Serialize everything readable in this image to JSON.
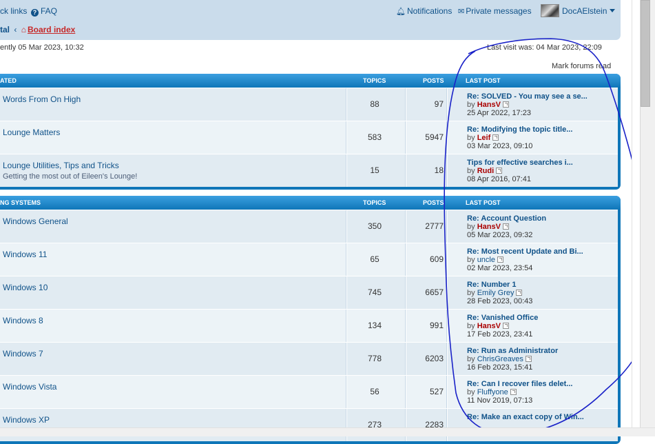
{
  "navbar": {
    "quick_links": "ck links",
    "faq": "FAQ",
    "notifications": "Notifications",
    "private_messages": "Private messages",
    "username": "DocAElstein",
    "breadcrumb_prev": "tal",
    "breadcrumb_sep": "‹",
    "board_index": "Board index"
  },
  "status": {
    "time_now": "ently 05 Mar 2023, 10:32",
    "last_visit": "Last visit was: 04 Mar 2023, 22:09",
    "mark_read": "Mark forums read"
  },
  "sections": [
    {
      "title": "ATED",
      "col_topics": "TOPICS",
      "col_posts": "POSTS",
      "col_last": "LAST POST",
      "rows": [
        {
          "name": "Words From On High",
          "desc": "",
          "topics": "88",
          "posts": "97",
          "lp_title": "Re: SOLVED - You may see a se...",
          "by": "by",
          "author": "HansV",
          "admin": true,
          "date": "25 Apr 2022, 17:23"
        },
        {
          "name": "Lounge Matters",
          "desc": "",
          "topics": "583",
          "posts": "5947",
          "lp_title": "Re: Modifying the topic title...",
          "by": "by",
          "author": "Leif",
          "admin": true,
          "date": "03 Mar 2023, 09:10"
        },
        {
          "name": "Lounge Utilities, Tips and Tricks",
          "desc": "Getting the most out of Eileen's Lounge!",
          "topics": "15",
          "posts": "18",
          "lp_title": "Tips for effective searches i...",
          "by": "by",
          "author": "Rudi",
          "admin": true,
          "date": "08 Apr 2016, 07:41"
        }
      ]
    },
    {
      "title": "NG SYSTEMS",
      "col_topics": "TOPICS",
      "col_posts": "POSTS",
      "col_last": "LAST POST",
      "rows": [
        {
          "name": "Windows General",
          "desc": "",
          "topics": "350",
          "posts": "2777",
          "lp_title": "Re: Account Question",
          "by": "by",
          "author": "HansV",
          "admin": true,
          "date": "05 Mar 2023, 09:32"
        },
        {
          "name": "Windows 11",
          "desc": "",
          "topics": "65",
          "posts": "609",
          "lp_title": "Re: Most recent Update and Bi...",
          "by": "by",
          "author": "uncle",
          "admin": false,
          "date": "02 Mar 2023, 23:54"
        },
        {
          "name": "Windows 10",
          "desc": "",
          "topics": "745",
          "posts": "6657",
          "lp_title": "Re: Number 1",
          "by": "by",
          "author": "Emily Grey",
          "admin": false,
          "date": "28 Feb 2023, 00:43"
        },
        {
          "name": "Windows 8",
          "desc": "",
          "topics": "134",
          "posts": "991",
          "lp_title": "Re: Vanished Office",
          "by": "by",
          "author": "HansV",
          "admin": true,
          "date": "17 Feb 2023, 23:41"
        },
        {
          "name": "Windows 7",
          "desc": "",
          "topics": "778",
          "posts": "6203",
          "lp_title": "Re: Run as Administrator",
          "by": "by",
          "author": "ChrisGreaves",
          "admin": false,
          "date": "16 Feb 2023, 15:41"
        },
        {
          "name": "Windows Vista",
          "desc": "",
          "topics": "56",
          "posts": "527",
          "lp_title": "Re: Can I recover files delet...",
          "by": "by",
          "author": "Fluffyone",
          "admin": false,
          "date": "11 Nov 2019, 07:13"
        },
        {
          "name": "Windows XP",
          "desc": "",
          "topics": "273",
          "posts": "2283",
          "lp_title": "Re: Make an exact copy of Win...",
          "by": "",
          "author": "",
          "admin": false,
          "date": ""
        }
      ]
    }
  ],
  "colors": {
    "header_blue": "#0f76b8",
    "link": "#105289",
    "admin_red": "#aa0000",
    "annotation": "#1a22c8"
  },
  "icons": [
    "bell-icon",
    "inbox-icon",
    "faq-icon",
    "home-icon",
    "caret-down-icon",
    "go-to-last-post-icon"
  ]
}
